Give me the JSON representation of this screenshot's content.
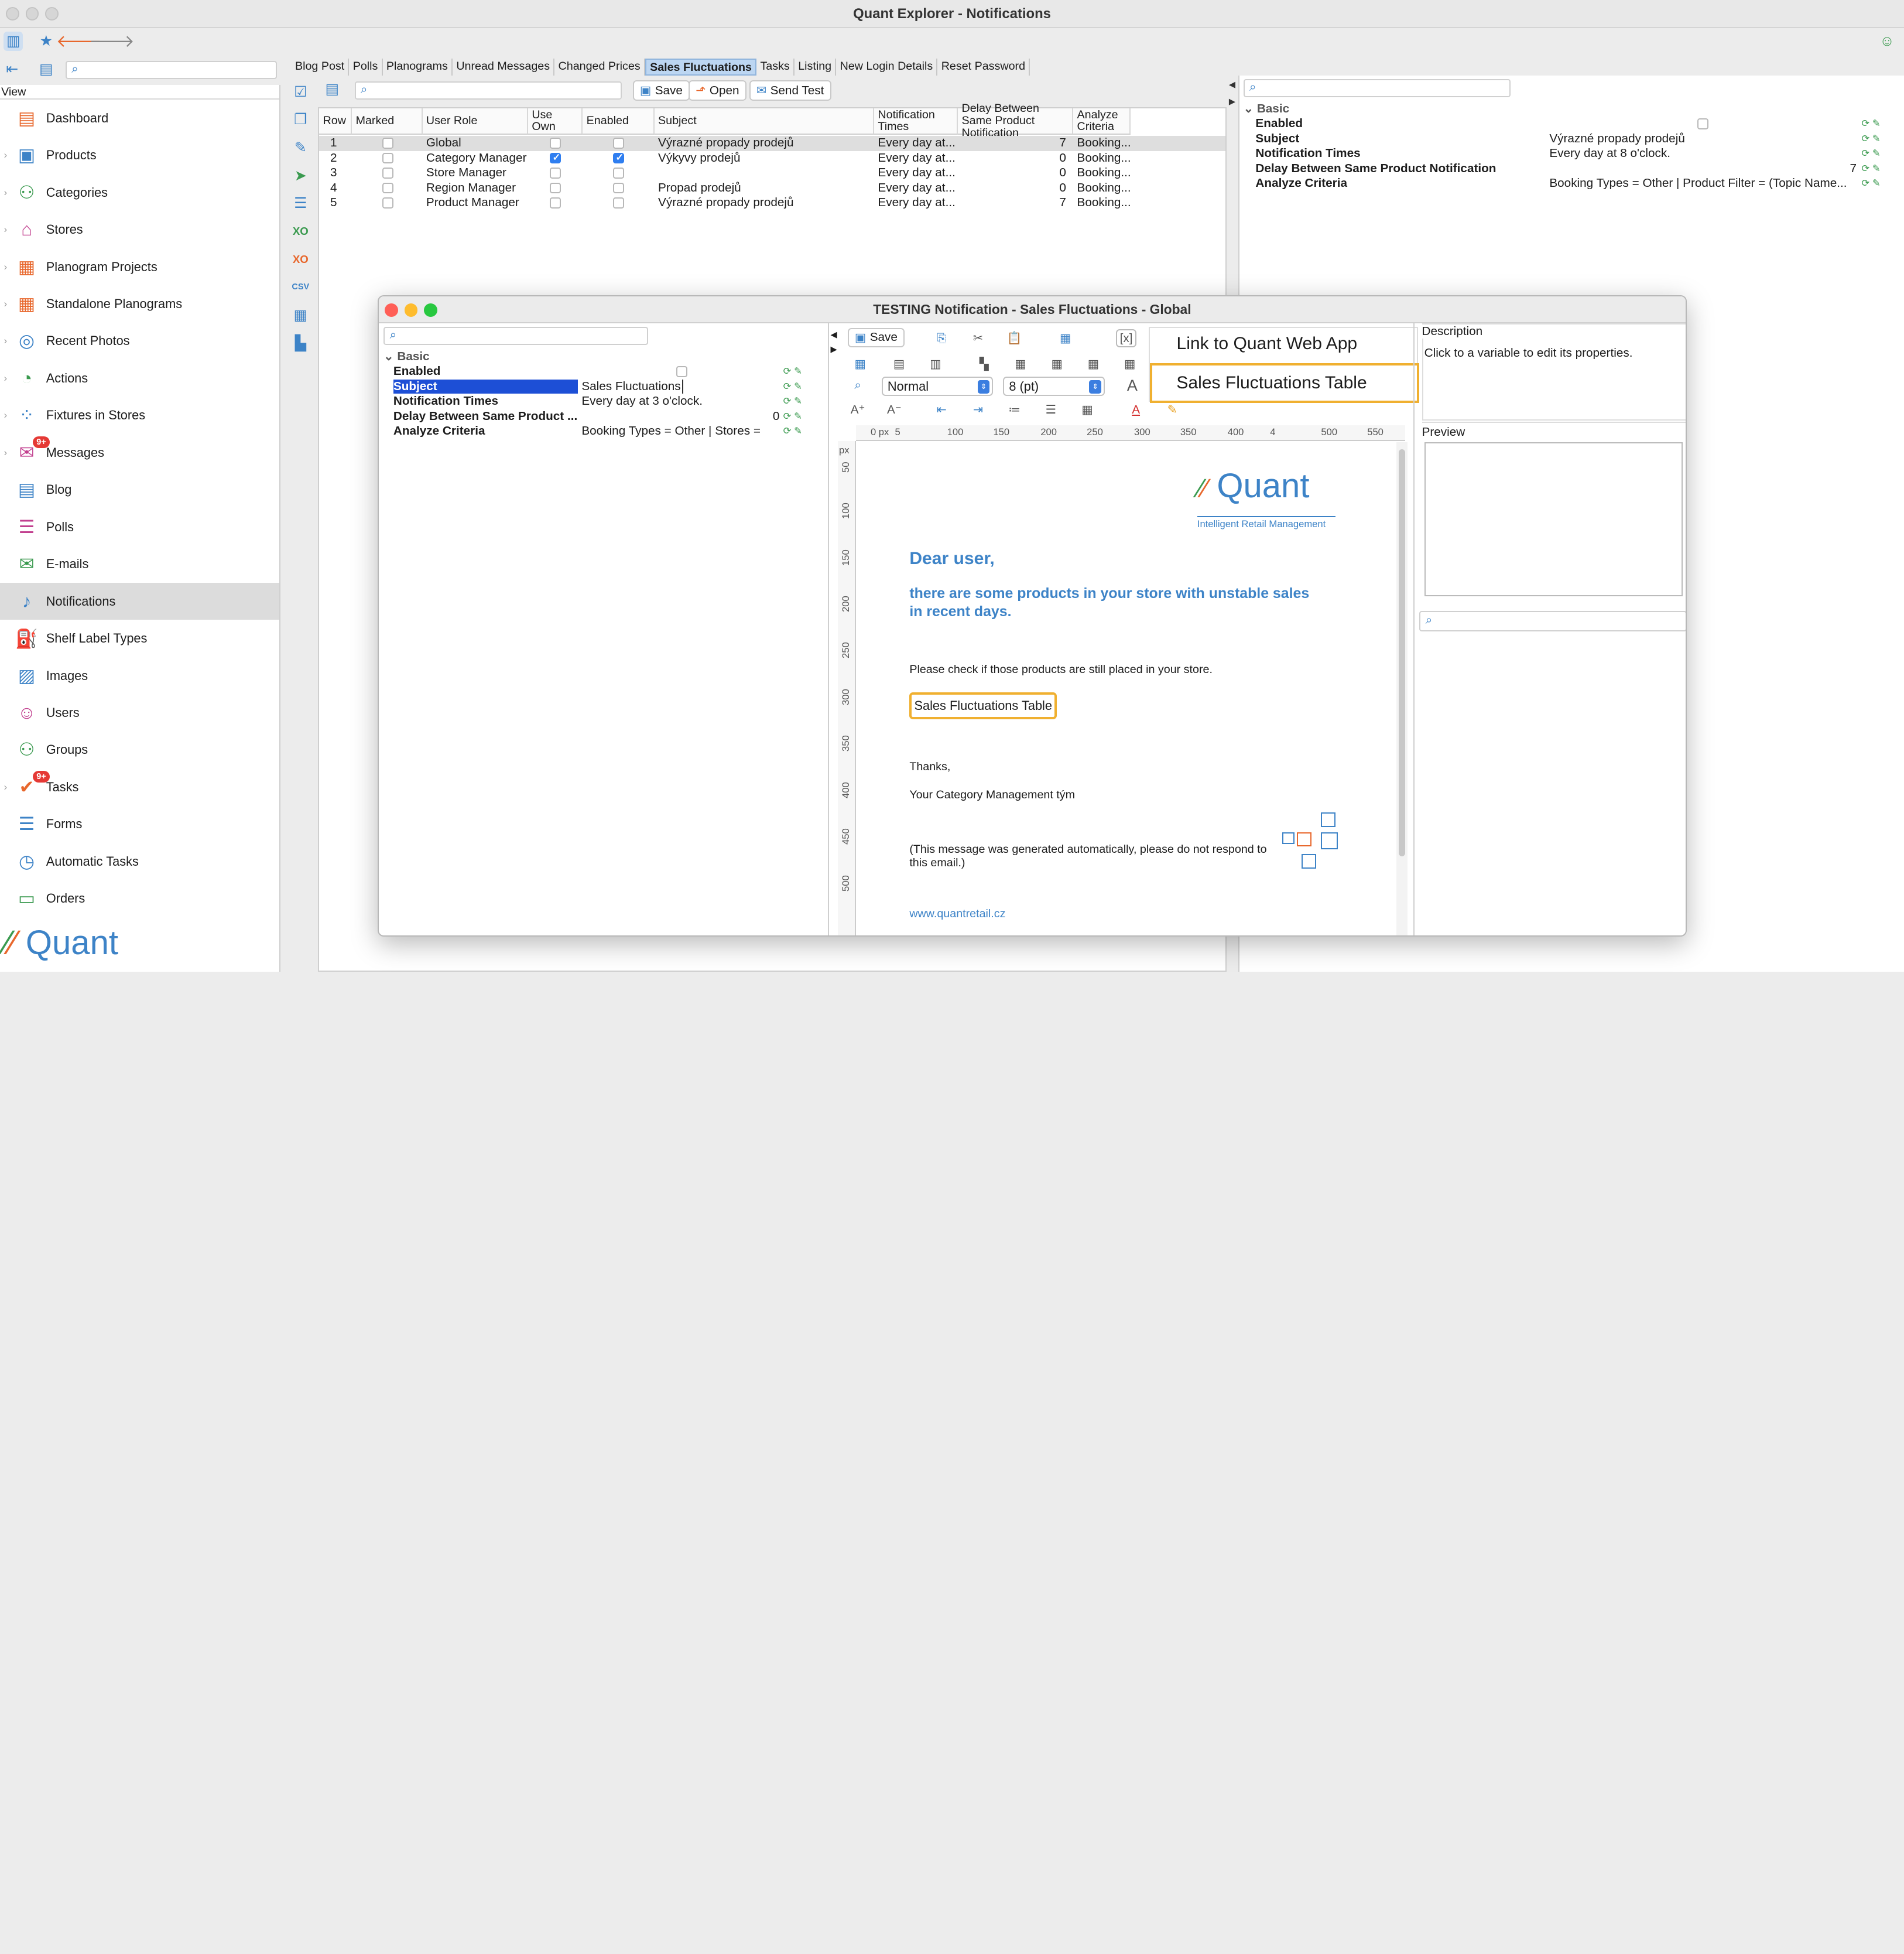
{
  "window_title": "Quant Explorer - Notifications",
  "sidebar": {
    "view_label": "View",
    "items": [
      {
        "label": "Dashboard",
        "icon": "dashboard-icon",
        "color": "#e8672c",
        "arrow": false
      },
      {
        "label": "Products",
        "icon": "products-icon",
        "color": "#3d83c7",
        "arrow": true
      },
      {
        "label": "Categories",
        "icon": "categories-icon",
        "color": "#3a9a4f",
        "arrow": true
      },
      {
        "label": "Stores",
        "icon": "stores-icon",
        "color": "#c2408f",
        "arrow": true
      },
      {
        "label": "Planogram Projects",
        "icon": "planogram-projects-icon",
        "color": "#e8672c",
        "arrow": true
      },
      {
        "label": "Standalone Planograms",
        "icon": "standalone-planograms-icon",
        "color": "#e8672c",
        "arrow": true
      },
      {
        "label": "Recent Photos",
        "icon": "recent-photos-icon",
        "color": "#3d83c7",
        "arrow": true
      },
      {
        "label": "Actions",
        "icon": "actions-icon",
        "color": "#3a9a4f",
        "arrow": true
      },
      {
        "label": "Fixtures in Stores",
        "icon": "fixtures-icon",
        "color": "#3d83c7",
        "arrow": true
      },
      {
        "label": "Messages",
        "icon": "messages-icon",
        "color": "#c2408f",
        "arrow": true,
        "badge": "9+"
      },
      {
        "label": "Blog",
        "icon": "blog-icon",
        "color": "#3d83c7",
        "arrow": false
      },
      {
        "label": "Polls",
        "icon": "polls-icon",
        "color": "#c2408f",
        "arrow": false
      },
      {
        "label": "E-mails",
        "icon": "emails-icon",
        "color": "#3a9a4f",
        "arrow": false
      },
      {
        "label": "Notifications",
        "icon": "notifications-icon",
        "color": "#3d83c7",
        "arrow": false,
        "selected": true
      },
      {
        "label": "Shelf Label Types",
        "icon": "shelf-label-types-icon",
        "color": "#e8672c",
        "arrow": false
      },
      {
        "label": "Images",
        "icon": "images-icon",
        "color": "#3d83c7",
        "arrow": false
      },
      {
        "label": "Users",
        "icon": "users-icon",
        "color": "#c2408f",
        "arrow": false
      },
      {
        "label": "Groups",
        "icon": "groups-icon",
        "color": "#3a9a4f",
        "arrow": false
      },
      {
        "label": "Tasks",
        "icon": "tasks-icon",
        "color": "#e8672c",
        "arrow": true,
        "badge": "9+"
      },
      {
        "label": "Forms",
        "icon": "forms-icon",
        "color": "#3d83c7",
        "arrow": false
      },
      {
        "label": "Automatic Tasks",
        "icon": "automatic-tasks-icon",
        "color": "#3d83c7",
        "arrow": false
      },
      {
        "label": "Orders",
        "icon": "orders-icon",
        "color": "#3a9a4f",
        "arrow": false
      }
    ],
    "logo_text": "Quant"
  },
  "tabs": [
    "Blog Post",
    "Polls",
    "Planograms",
    "Unread Messages",
    "Changed Prices",
    "Sales Fluctuations",
    "Tasks",
    "Listing",
    "New Login Details",
    "Reset Password"
  ],
  "selected_tab": "Sales Fluctuations",
  "toolbar": {
    "save": "Save",
    "open": "Open",
    "send_test": "Send Test"
  },
  "table": {
    "headers": [
      "Row",
      "Marked",
      "User Role",
      "Use Own",
      "Enabled",
      "Subject",
      "Notification Times",
      "Delay Between Same Product Notification",
      "Analyze Criteria"
    ],
    "rows": [
      {
        "row": "1",
        "role": "Global",
        "use_own": false,
        "enabled": false,
        "subject": "Výrazné propady prodejů",
        "times": "Every day at...",
        "delay": "7",
        "criteria": "Booking..."
      },
      {
        "row": "2",
        "role": "Category Manager",
        "use_own": true,
        "enabled": true,
        "subject": "Výkyvy prodejů",
        "times": "Every day at...",
        "delay": "0",
        "criteria": "Booking..."
      },
      {
        "row": "3",
        "role": "Store Manager",
        "use_own": false,
        "enabled": false,
        "subject": "",
        "times": "Every day at...",
        "delay": "0",
        "criteria": "Booking..."
      },
      {
        "row": "4",
        "role": "Region Manager",
        "use_own": false,
        "enabled": false,
        "subject": "Propad prodejů",
        "times": "Every day at...",
        "delay": "0",
        "criteria": "Booking..."
      },
      {
        "row": "5",
        "role": "Product Manager",
        "use_own": false,
        "enabled": false,
        "subject": "Výrazné propady prodejů",
        "times": "Every day at...",
        "delay": "7",
        "criteria": "Booking..."
      }
    ]
  },
  "right_panel": {
    "section": "Basic",
    "props": [
      {
        "name": "Enabled",
        "value": ""
      },
      {
        "name": "Subject",
        "value": "Výrazné propady prodejů"
      },
      {
        "name": "Notification Times",
        "value": "Every day at 8 o'clock."
      },
      {
        "name": "Delay Between Same Product Notification",
        "value": "7"
      },
      {
        "name": "Analyze Criteria",
        "value": "Booking Types = Other | Product Filter = (Topic Name..."
      }
    ]
  },
  "dialog": {
    "title": "TESTING Notification - Sales Fluctuations - Global",
    "section": "Basic",
    "props": [
      {
        "name": "Enabled",
        "value": ""
      },
      {
        "name": "Subject",
        "value": "Sales Fluctuations"
      },
      {
        "name": "Notification Times",
        "value": "Every day at 3 o'clock."
      },
      {
        "name": "Delay Between Same Product ...",
        "value": "0"
      },
      {
        "name": "Analyze Criteria",
        "value": "Booking Types = Other | Stores ="
      }
    ],
    "save": "Save",
    "style_select": "Normal",
    "size_select": "8 (pt)",
    "menu_items": [
      "Link to Quant Web App",
      "Sales Fluctuations Table"
    ],
    "description_label": "Description",
    "description_text": "Click to a variable to edit its properties.",
    "preview_label": "Preview",
    "ruler_unit": "px",
    "ruler_top": [
      "0 px",
      "5",
      "100",
      "150",
      "200",
      "250",
      "300",
      "350",
      "400",
      "4",
      "500",
      "550"
    ],
    "ruler_left": [
      "50",
      "100",
      "150",
      "200",
      "250",
      "300",
      "350",
      "400",
      "450",
      "500"
    ],
    "email": {
      "logo": "Quant",
      "logo_sub": "Intelligent Retail Management",
      "greeting": "Dear user,",
      "lead": "there are some products in your store with unstable sales in recent days.",
      "check": "Please check if those products are still placed in your store.",
      "variable": "Sales Fluctuations Table",
      "thanks": "Thanks,",
      "sign": "Your Category Management tým",
      "note": "(This message was generated automatically, please do not respond to this email.)",
      "link": "www.quantretail.cz"
    }
  }
}
